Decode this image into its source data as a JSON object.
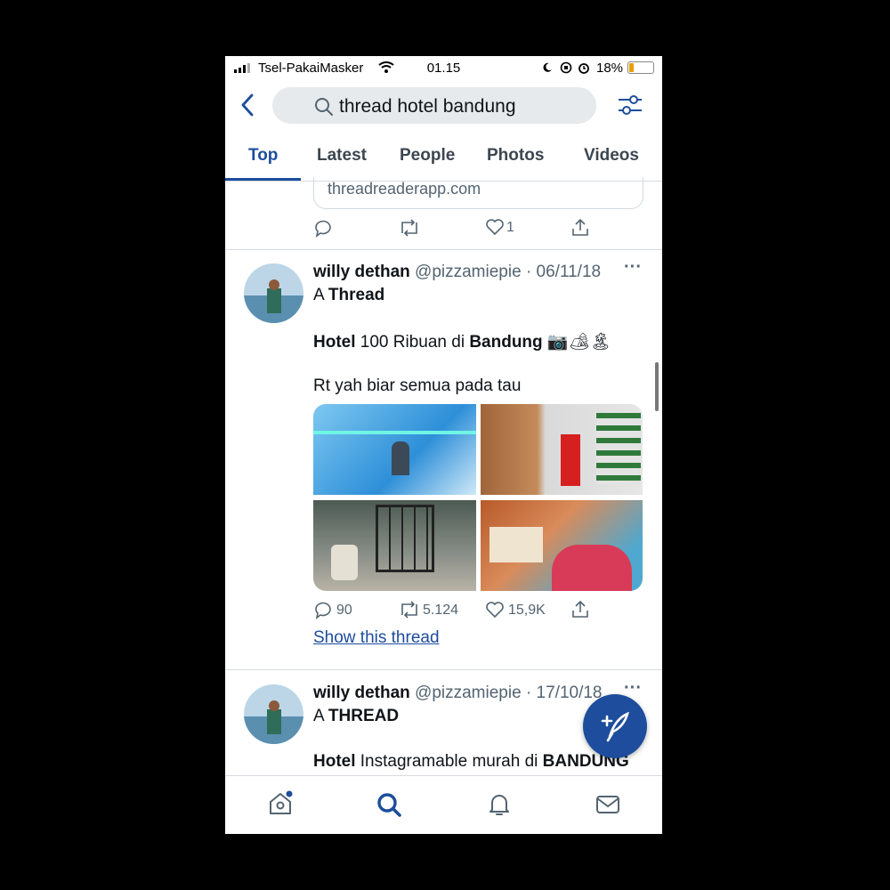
{
  "status_bar": {
    "carrier": "Tsel-PakaiMasker",
    "time": "01.15",
    "battery": "18%",
    "icons": [
      "signal-icon",
      "wifi-icon",
      "moon-icon",
      "orientation-lock-icon",
      "alarm-icon",
      "battery-icon"
    ]
  },
  "header": {
    "search_query": "thread hotel bandung",
    "back_icon": "back-arrow-icon",
    "filter_icon": "filter-icon"
  },
  "tabs": [
    {
      "label": "Top",
      "active": true
    },
    {
      "label": "Latest",
      "active": false
    },
    {
      "label": "People",
      "active": false
    },
    {
      "label": "Photos",
      "active": false
    },
    {
      "label": "Videos",
      "active": false
    }
  ],
  "previous_tweet": {
    "card_url": "threadreaderapp.com",
    "likes": "1"
  },
  "tweet1": {
    "name": "willy dethan",
    "handle": "@pizzamiepie",
    "date": "· 06/11/18",
    "more": "···",
    "line1_pre": "A ",
    "line1_bold": "Thread",
    "line2_bold1": "Hotel",
    "line2_mid": " 100 Ribuan di ",
    "line2_bold2": "Bandung",
    "line2_emoji": " 📷🏕🏝",
    "line3": "Rt yah biar semua pada tau",
    "replies": "90",
    "retweets": "5.124",
    "likes": "15,9K",
    "show_thread": "Show this thread"
  },
  "tweet2": {
    "name": "willy dethan",
    "handle": "@pizzamiepie",
    "date": "· 17/10/18",
    "more": "···",
    "line1_pre": "A ",
    "line1_bold": "THREAD",
    "line2_bold1": "Hotel",
    "line2_mid": " Instagramable murah di ",
    "line2_bold2": "BANDUNG"
  },
  "fab_icon": "compose-icon",
  "bottom_nav": [
    "home-icon",
    "search-icon",
    "notifications-icon",
    "messages-icon"
  ],
  "colors": {
    "accent": "#1d4d9c",
    "text": "#0f1419",
    "muted": "#536471",
    "divider": "#d7dce0"
  }
}
